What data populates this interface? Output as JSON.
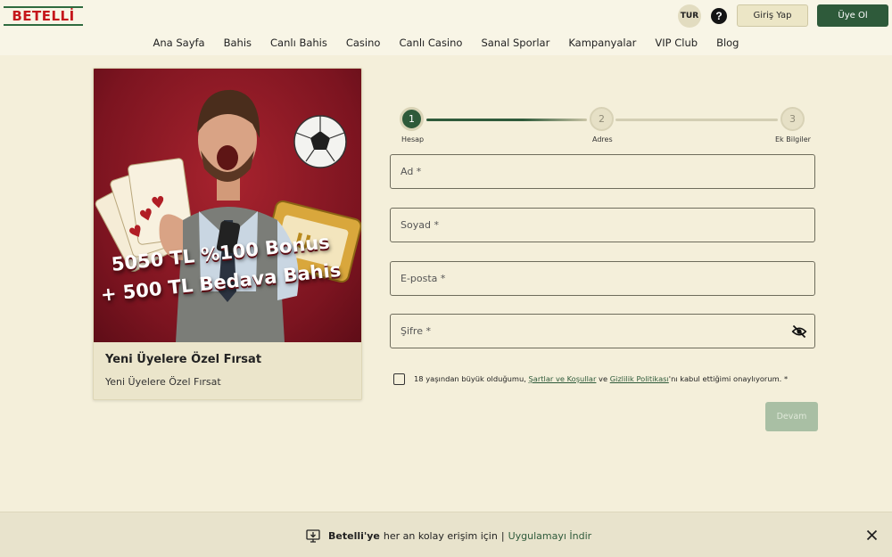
{
  "header": {
    "logo_text": "BETELLİ",
    "language": "TUR",
    "help_glyph": "?",
    "login_label": "Giriş Yap",
    "register_label": "Üye Ol"
  },
  "nav": {
    "items": [
      "Ana Sayfa",
      "Bahis",
      "Canlı Bahis",
      "Casino",
      "Canlı Casino",
      "Sanal Sporlar",
      "Kampanyalar",
      "VIP Club",
      "Blog"
    ]
  },
  "promo": {
    "bonus_line1": "5050 TL %100 Bonus",
    "bonus_line2": "+ 500 TL Bedava Bahis",
    "title": "Yeni Üyelere Özel Fırsat",
    "subtitle": "Yeni Üyelere Özel Fırsat"
  },
  "stepper": {
    "steps": [
      {
        "number": "1",
        "label": "Hesap",
        "state": "active"
      },
      {
        "number": "2",
        "label": "Adres",
        "state": "pending"
      },
      {
        "number": "3",
        "label": "Ek Bilgiler",
        "state": "pending"
      }
    ]
  },
  "form": {
    "ad_placeholder": "Ad *",
    "soyad_placeholder": "Soyad *",
    "eposta_placeholder": "E-posta *",
    "sifre_placeholder": "Şifre *",
    "consent_prefix": "18 yaşından büyük olduğumu, ",
    "consent_terms_link": "Şartlar ve Koşullar",
    "consent_and": " ve ",
    "consent_privacy_link": "Gizlilik Politikası",
    "consent_suffix": "'nı kabul ettiğimi onaylıyorum. *",
    "continue_label": "Devam"
  },
  "app_banner": {
    "brand": "Betelli'ye",
    "text": "her an kolay erişim için",
    "separator": "|",
    "link": "Uygulamayı İndir"
  },
  "colors": {
    "accent": "#2e5a3a",
    "brand_red": "#c5171c",
    "background": "#f4efda"
  },
  "icons": {
    "help": "question-circle-icon",
    "eye": "eye-off-icon",
    "download": "monitor-download-icon",
    "close": "close-icon"
  }
}
